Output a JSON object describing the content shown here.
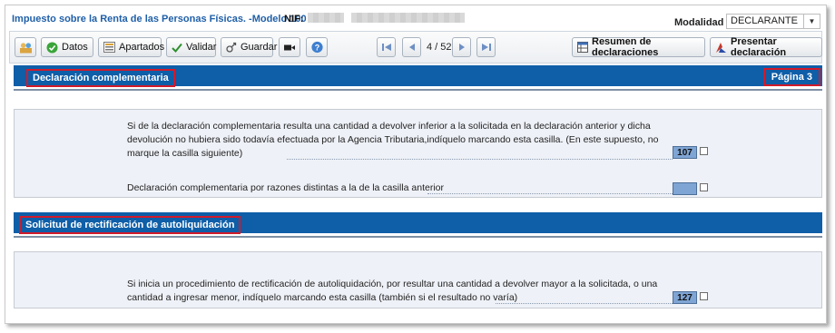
{
  "header": {
    "app_title": "Impuesto sobre la Renta de las Personas Físicas. -Modelo 100",
    "nif_label": "NIF:",
    "modalidad_label": "Modalidad",
    "modalidad_value": "DECLARANTE"
  },
  "toolbar": {
    "datos": "Datos",
    "apartados": "Apartados",
    "validar": "Validar",
    "guardar": "Guardar",
    "page_indicator": "4 / 52",
    "resumen": "Resumen de declaraciones",
    "presentar": "Presentar declaración"
  },
  "section1": {
    "title": "Declaración complementaria",
    "page": "Página 3",
    "item1_text": "Si de la declaración complementaria resulta una cantidad a devolver inferior a la solicitada en la declaración anterior y dicha devolución no hubiera sido todavía efectuada por la Agencia Tributaria,indíquelo marcando esta casilla. (En este supuesto, no marque la casilla siguiente)",
    "item1_box": "107",
    "item2_text": "Declaración complementaria por razones distintas a la de la casilla anterior",
    "item2_box": ""
  },
  "section2": {
    "title": "Solicitud de rectificación de autoliquidación",
    "item1_text": "Si inicia un procedimiento de rectificación de autoliquidación, por resultar una cantidad a devolver mayor a la solicitada, o una cantidad a ingresar menor, indíquelo marcando esta casilla (también si el resultado no varía)",
    "item1_box": "127"
  },
  "colors": {
    "section_blue": "#0e5ea8",
    "highlight_red": "#d11a2a",
    "title_blue": "#1f5fa8"
  }
}
